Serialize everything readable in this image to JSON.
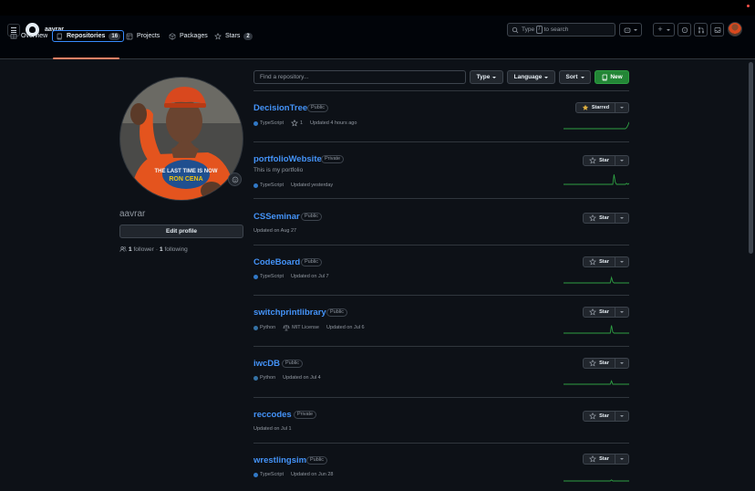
{
  "header": {
    "username": "aavrar",
    "search_text_before": "Type",
    "search_key": "/",
    "search_text_after": "to search"
  },
  "nav": {
    "tabs": [
      {
        "label": "Overview"
      },
      {
        "label": "Repositories",
        "count": "16"
      },
      {
        "label": "Projects"
      },
      {
        "label": "Packages"
      },
      {
        "label": "Stars",
        "count": "2"
      }
    ]
  },
  "profile": {
    "name": "aavrar",
    "edit_label": "Edit profile",
    "followers": "1",
    "followers_label": "follower",
    "separator": "·",
    "following": "1",
    "following_label": "following"
  },
  "filters": {
    "search_placeholder": "Find a repository...",
    "type_label": "Type",
    "language_label": "Language",
    "sort_label": "Sort",
    "new_label": "New"
  },
  "colors": {
    "accent_link": "#4493f8",
    "typescript": "#3178c6",
    "python": "#3572A5",
    "new_button": "#238636",
    "starred": "#e3b341",
    "sparkline": "#2ea043"
  },
  "repos": [
    {
      "name": "DecisionTree",
      "visibility": "Public",
      "language": "TypeScript",
      "stars": "1",
      "updated": "Updated 4 hours ago",
      "star_label": "Starred",
      "starred": true,
      "activity": [
        0,
        0,
        0,
        0,
        0,
        0,
        0,
        0,
        0,
        0,
        0,
        0,
        0,
        0,
        0,
        0,
        0,
        0,
        0,
        0,
        0,
        0,
        0,
        0,
        0,
        0,
        0,
        0,
        0,
        0,
        0,
        0,
        0,
        0,
        0,
        0,
        0,
        0,
        0,
        0,
        0,
        0,
        0,
        0,
        0,
        0,
        0,
        0,
        0,
        0,
        1,
        3,
        6
      ]
    },
    {
      "name": "portfolioWebsite",
      "visibility": "Private",
      "description": "This is my portfolio",
      "language": "TypeScript",
      "updated": "Updated yesterday",
      "star_label": "Star",
      "activity": [
        0,
        0,
        0,
        0,
        0,
        0,
        0,
        0,
        0,
        0,
        0,
        0,
        0,
        0,
        0,
        0,
        0,
        0,
        0,
        0,
        0,
        0,
        0,
        0,
        0,
        0,
        0,
        0,
        0,
        0,
        0,
        0,
        0,
        0,
        0,
        0,
        0,
        0,
        0,
        0,
        9,
        2,
        0,
        0,
        0,
        0,
        0,
        0,
        0,
        0,
        1,
        0,
        1
      ]
    },
    {
      "name": "CSSeminar",
      "visibility": "Public",
      "updated": "Updated on Aug 27",
      "star_label": "Star"
    },
    {
      "name": "CodeBoard",
      "visibility": "Public",
      "language": "TypeScript",
      "updated": "Updated on Jul 7",
      "star_label": "Star",
      "activity": [
        0,
        0,
        0,
        0,
        0,
        0,
        0,
        0,
        0,
        0,
        0,
        0,
        0,
        0,
        0,
        0,
        0,
        0,
        0,
        0,
        0,
        0,
        0,
        0,
        0,
        0,
        0,
        0,
        0,
        0,
        0,
        0,
        0,
        0,
        0,
        0,
        0,
        0,
        5,
        1,
        0,
        0,
        0,
        0,
        0,
        0,
        0,
        0,
        0,
        0,
        0,
        0,
        0
      ]
    },
    {
      "name": "switchprintlibrary",
      "visibility": "Public",
      "language": "Python",
      "license": "MIT License",
      "updated": "Updated on Jul 6",
      "star_label": "Star",
      "activity": [
        0,
        0,
        0,
        0,
        0,
        0,
        0,
        0,
        0,
        0,
        0,
        0,
        0,
        0,
        0,
        0,
        0,
        0,
        0,
        0,
        0,
        0,
        0,
        0,
        0,
        0,
        0,
        0,
        0,
        0,
        0,
        0,
        0,
        0,
        0,
        0,
        0,
        0,
        7,
        1,
        0,
        0,
        0,
        0,
        0,
        0,
        0,
        0,
        0,
        0,
        0,
        0,
        0
      ]
    },
    {
      "name": "iwcDB",
      "visibility": "Public",
      "language": "Python",
      "updated": "Updated on Jul 4",
      "star_label": "Star",
      "activity": [
        0,
        0,
        0,
        0,
        0,
        0,
        0,
        0,
        0,
        0,
        0,
        0,
        0,
        0,
        0,
        0,
        0,
        0,
        0,
        0,
        0,
        0,
        0,
        0,
        0,
        0,
        0,
        0,
        0,
        0,
        0,
        0,
        0,
        0,
        0,
        0,
        0,
        0,
        3,
        0,
        0,
        0,
        0,
        0,
        0,
        0,
        0,
        0,
        0,
        0,
        0,
        0,
        0
      ]
    },
    {
      "name": "reccodes",
      "visibility": "Private",
      "updated": "Updated on Jul 1",
      "star_label": "Star"
    },
    {
      "name": "wrestlingsim",
      "visibility": "Public",
      "language": "TypeScript",
      "updated": "Updated on Jun 28",
      "star_label": "Star",
      "activity": [
        0,
        0,
        0,
        0,
        0,
        0,
        0,
        0,
        0,
        0,
        0,
        0,
        0,
        0,
        0,
        0,
        0,
        0,
        0,
        0,
        0,
        0,
        0,
        0,
        0,
        0,
        0,
        0,
        0,
        0,
        0,
        0,
        0,
        0,
        0,
        0,
        0,
        0,
        1,
        0,
        0,
        0,
        0,
        0,
        0,
        0,
        0,
        0,
        0,
        0,
        0,
        0,
        0
      ]
    }
  ]
}
